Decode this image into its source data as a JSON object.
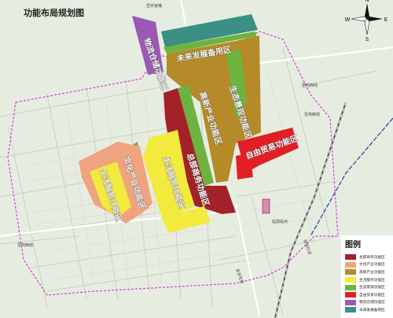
{
  "title": "功能布局规划图",
  "compass": {
    "n": "N",
    "s": "S",
    "e": "E",
    "w": "W"
  },
  "legend": {
    "title": "图例",
    "items": [
      {
        "label": "总部商务功能区",
        "color": "#a3222a"
      },
      {
        "label": "文创产业功能区",
        "color": "#f0a37f"
      },
      {
        "label": "高新产业功能区",
        "color": "#b58a28"
      },
      {
        "label": "生活服务功能区",
        "color": "#f2ea3c"
      },
      {
        "label": "生态景观功能区",
        "color": "#6db33f"
      },
      {
        "label": "自由贸易功能区",
        "color": "#e21f26"
      },
      {
        "label": "物流仓储功能区",
        "color": "#9b59b6"
      },
      {
        "label": "未来发展备用区",
        "color": "#3b8f83"
      }
    ]
  },
  "zones": {
    "future": "未来发展备用区",
    "logistics": "物流仓储功能区",
    "hitech": "高新产业功能区",
    "eco": "生态景观功能区",
    "trade": "自由贸易功能区",
    "hq": "总部商务功能区",
    "life": "生活服务功能区",
    "culture": "文化产业功能区",
    "life2": "生活服务功能区"
  },
  "roads": {
    "r1": "至乔家嘴",
    "r2": "至鸡西线",
    "r3": "至鸡西线",
    "r4": "至鸡西线",
    "r5": "至牙克石",
    "r6": "至哈尔滨",
    "station": "站前站点"
  }
}
